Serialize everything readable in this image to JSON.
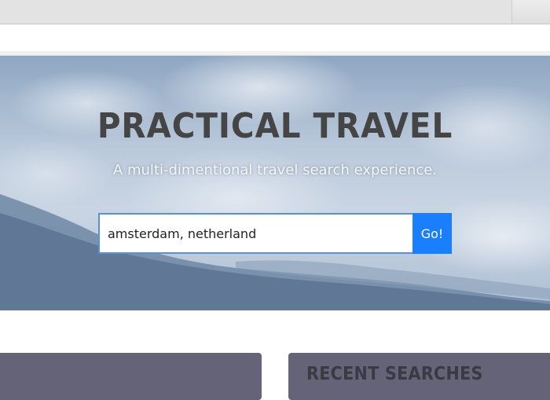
{
  "hero": {
    "title": "PRACTICAL TRAVEL",
    "subtitle": "A multi-dimentional travel search experience."
  },
  "search": {
    "value": "amsterdam, netherland",
    "button_label": "Go!"
  },
  "panels": {
    "recent_searches_title": "RECENT SEARCHES"
  },
  "colors": {
    "go_button": "#1a7fff",
    "panel_bg": "#646378",
    "title_text": "#454545"
  }
}
